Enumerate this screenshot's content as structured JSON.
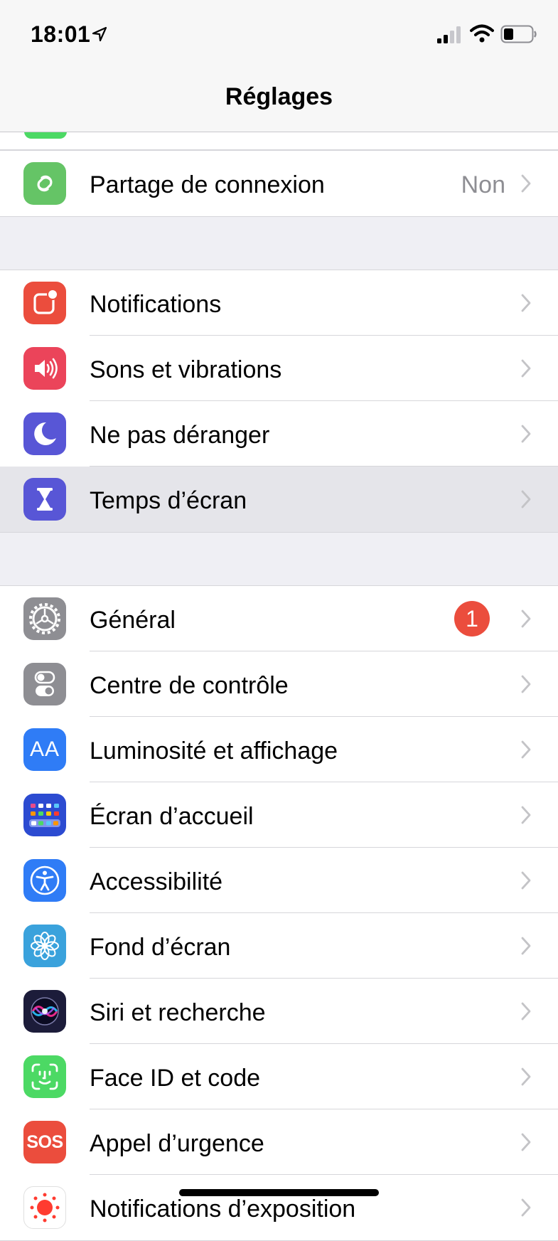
{
  "status": {
    "time": "18:01"
  },
  "nav": {
    "title": "Réglages"
  },
  "group1": [
    {
      "label": "Partage de connexion",
      "value": "Non",
      "icon": "hotspot-icon",
      "color": "#65c466"
    }
  ],
  "group2": [
    {
      "label": "Notifications",
      "icon": "notifications-icon",
      "color": "#eb4d3d"
    },
    {
      "label": "Sons et vibrations",
      "icon": "sounds-icon",
      "color": "#eb445a"
    },
    {
      "label": "Ne pas déranger",
      "icon": "moon-icon",
      "color": "#5856d6"
    },
    {
      "label": "Temps d’écran",
      "icon": "hourglass-icon",
      "color": "#5856d6",
      "highlighted": true
    }
  ],
  "group3": [
    {
      "label": "Général",
      "icon": "gear-icon",
      "color": "#8e8e93",
      "badge": "1"
    },
    {
      "label": "Centre de contrôle",
      "icon": "toggles-icon",
      "color": "#8e8e93"
    },
    {
      "label": "Luminosité et affichage",
      "icon": "text-size-icon",
      "color": "#2f7cf6",
      "icon_text": "AA"
    },
    {
      "label": "Écran d’accueil",
      "icon": "home-screen-icon",
      "color": "#2c4bd1"
    },
    {
      "label": "Accessibilité",
      "icon": "accessibility-icon",
      "color": "#2f7cf6"
    },
    {
      "label": "Fond d’écran",
      "icon": "wallpaper-icon",
      "color": "#3aa2dc"
    },
    {
      "label": "Siri et recherche",
      "icon": "siri-icon",
      "color": "#1c1c3a"
    },
    {
      "label": "Face ID et code",
      "icon": "face-id-icon",
      "color": "#4cd964"
    },
    {
      "label": "Appel d’urgence",
      "icon": "sos-icon",
      "color": "#eb4d3d",
      "icon_text": "SOS"
    },
    {
      "label": "Notifications d’exposition",
      "icon": "exposure-icon",
      "color": "#ffffff"
    }
  ]
}
